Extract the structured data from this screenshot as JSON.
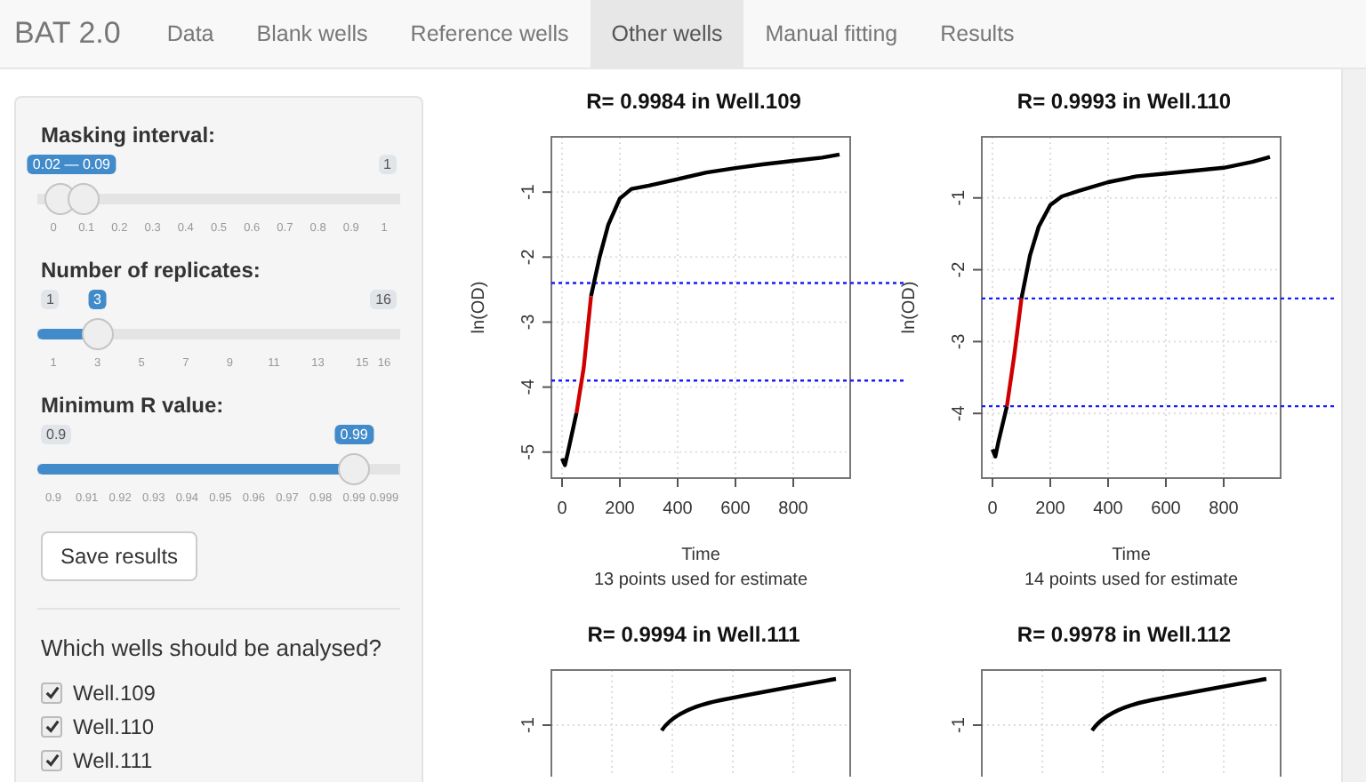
{
  "navbar": {
    "brand": "BAT 2.0",
    "tabs": [
      {
        "label": "Data",
        "selected": false
      },
      {
        "label": "Blank wells",
        "selected": false
      },
      {
        "label": "Reference wells",
        "selected": false
      },
      {
        "label": "Other wells",
        "selected": true
      },
      {
        "label": "Manual fitting",
        "selected": false
      },
      {
        "label": "Results",
        "selected": false
      }
    ]
  },
  "sidebar": {
    "sliders": [
      {
        "kind": "range",
        "label": "Masking interval:",
        "from": "0.02",
        "separator": "—",
        "to": "0.09",
        "max_label": "1",
        "ticks": [
          "0",
          "0.1",
          "0.2",
          "0.3",
          "0.4",
          "0.5",
          "0.6",
          "0.7",
          "0.8",
          "0.9",
          "1"
        ]
      },
      {
        "kind": "single",
        "label": "Number of replicates:",
        "min_label": "1",
        "value_label": "3",
        "max_label": "16",
        "level": 0.133,
        "ticks": [
          "1",
          "3",
          "5",
          "7",
          "9",
          "11",
          "13",
          "15",
          "16"
        ]
      },
      {
        "kind": "single",
        "label": "Minimum R value:",
        "min_label": "0.9",
        "value_label": "0.99",
        "level": 0.909,
        "ticks": [
          "0.9",
          "0.91",
          "0.92",
          "0.93",
          "0.94",
          "0.95",
          "0.96",
          "0.97",
          "0.98",
          "0.99",
          "0.999"
        ]
      }
    ],
    "save_button": "Save results",
    "wells_heading": "Which wells should be analysed?",
    "wells": [
      {
        "label": "Well.109",
        "checked": true
      },
      {
        "label": "Well.110",
        "checked": true
      },
      {
        "label": "Well.111",
        "checked": true
      }
    ]
  },
  "plots": [
    {
      "chart_data": {
        "type": "line",
        "title": "R= 0.9984 in Well.109",
        "xlabel": "Time",
        "ylabel": "ln(OD)",
        "grid": true,
        "x": [
          0,
          10,
          20,
          50,
          75,
          100,
          130,
          160,
          200,
          240,
          300,
          400,
          500,
          600,
          700,
          800,
          900,
          960
        ],
        "xlim": [
          -37,
          997
        ],
        "ylim": [
          -5.4,
          -0.15
        ],
        "xticks": [
          0,
          200,
          400,
          600,
          800
        ],
        "yticks": [
          -5,
          -4,
          -3,
          -2,
          -1
        ],
        "series": [
          {
            "color": "#000000",
            "values": [
              -5.1,
              -5.2,
              -5.0,
              -4.4,
              null,
              -2.6,
              -2.0,
              -1.5,
              -1.1,
              -0.95,
              -0.9,
              -0.8,
              -0.7,
              -0.63,
              -0.57,
              -0.52,
              -0.47,
              -0.42
            ]
          },
          {
            "color": "#d00000",
            "values": [
              null,
              null,
              null,
              -4.4,
              -3.7,
              -2.6,
              null,
              null,
              null,
              null,
              null,
              null,
              null,
              null,
              null,
              null,
              null,
              null
            ]
          }
        ],
        "ref_lines": [
          {
            "axis": "y",
            "value": -2.4,
            "color": "#1a1aff"
          },
          {
            "axis": "y",
            "value": -3.9,
            "color": "#1a1aff"
          }
        ]
      },
      "caption": "13 points used for estimate"
    },
    {
      "chart_data": {
        "type": "line",
        "title": "R= 0.9993 in Well.110",
        "xlabel": "Time",
        "ylabel": "ln(OD)",
        "grid": true,
        "x": [
          0,
          10,
          20,
          50,
          75,
          100,
          130,
          160,
          200,
          240,
          300,
          400,
          500,
          600,
          700,
          800,
          900,
          960
        ],
        "xlim": [
          -37,
          997
        ],
        "ylim": [
          -4.9,
          -0.15
        ],
        "xticks": [
          0,
          200,
          400,
          600,
          800
        ],
        "yticks": [
          -4,
          -3,
          -2,
          -1
        ],
        "series": [
          {
            "color": "#000000",
            "values": [
              -4.5,
              -4.6,
              -4.4,
              -3.9,
              null,
              -2.4,
              -1.8,
              -1.4,
              -1.1,
              -0.98,
              -0.9,
              -0.78,
              -0.7,
              -0.66,
              -0.62,
              -0.58,
              -0.5,
              -0.43
            ]
          },
          {
            "color": "#d00000",
            "values": [
              null,
              null,
              null,
              -3.9,
              -3.2,
              -2.4,
              null,
              null,
              null,
              null,
              null,
              null,
              null,
              null,
              null,
              null,
              null,
              null
            ]
          }
        ],
        "ref_lines": [
          {
            "axis": "y",
            "value": -2.4,
            "color": "#1a1aff"
          },
          {
            "axis": "y",
            "value": -3.9,
            "color": "#1a1aff"
          }
        ]
      },
      "caption": "14 points used for estimate"
    },
    {
      "kind": "partial",
      "title": "R= 0.9994 in Well.111",
      "y_tick_label": "-1"
    },
    {
      "kind": "partial",
      "title": "R= 0.9978 in Well.112",
      "y_tick_label": "-1"
    }
  ]
}
